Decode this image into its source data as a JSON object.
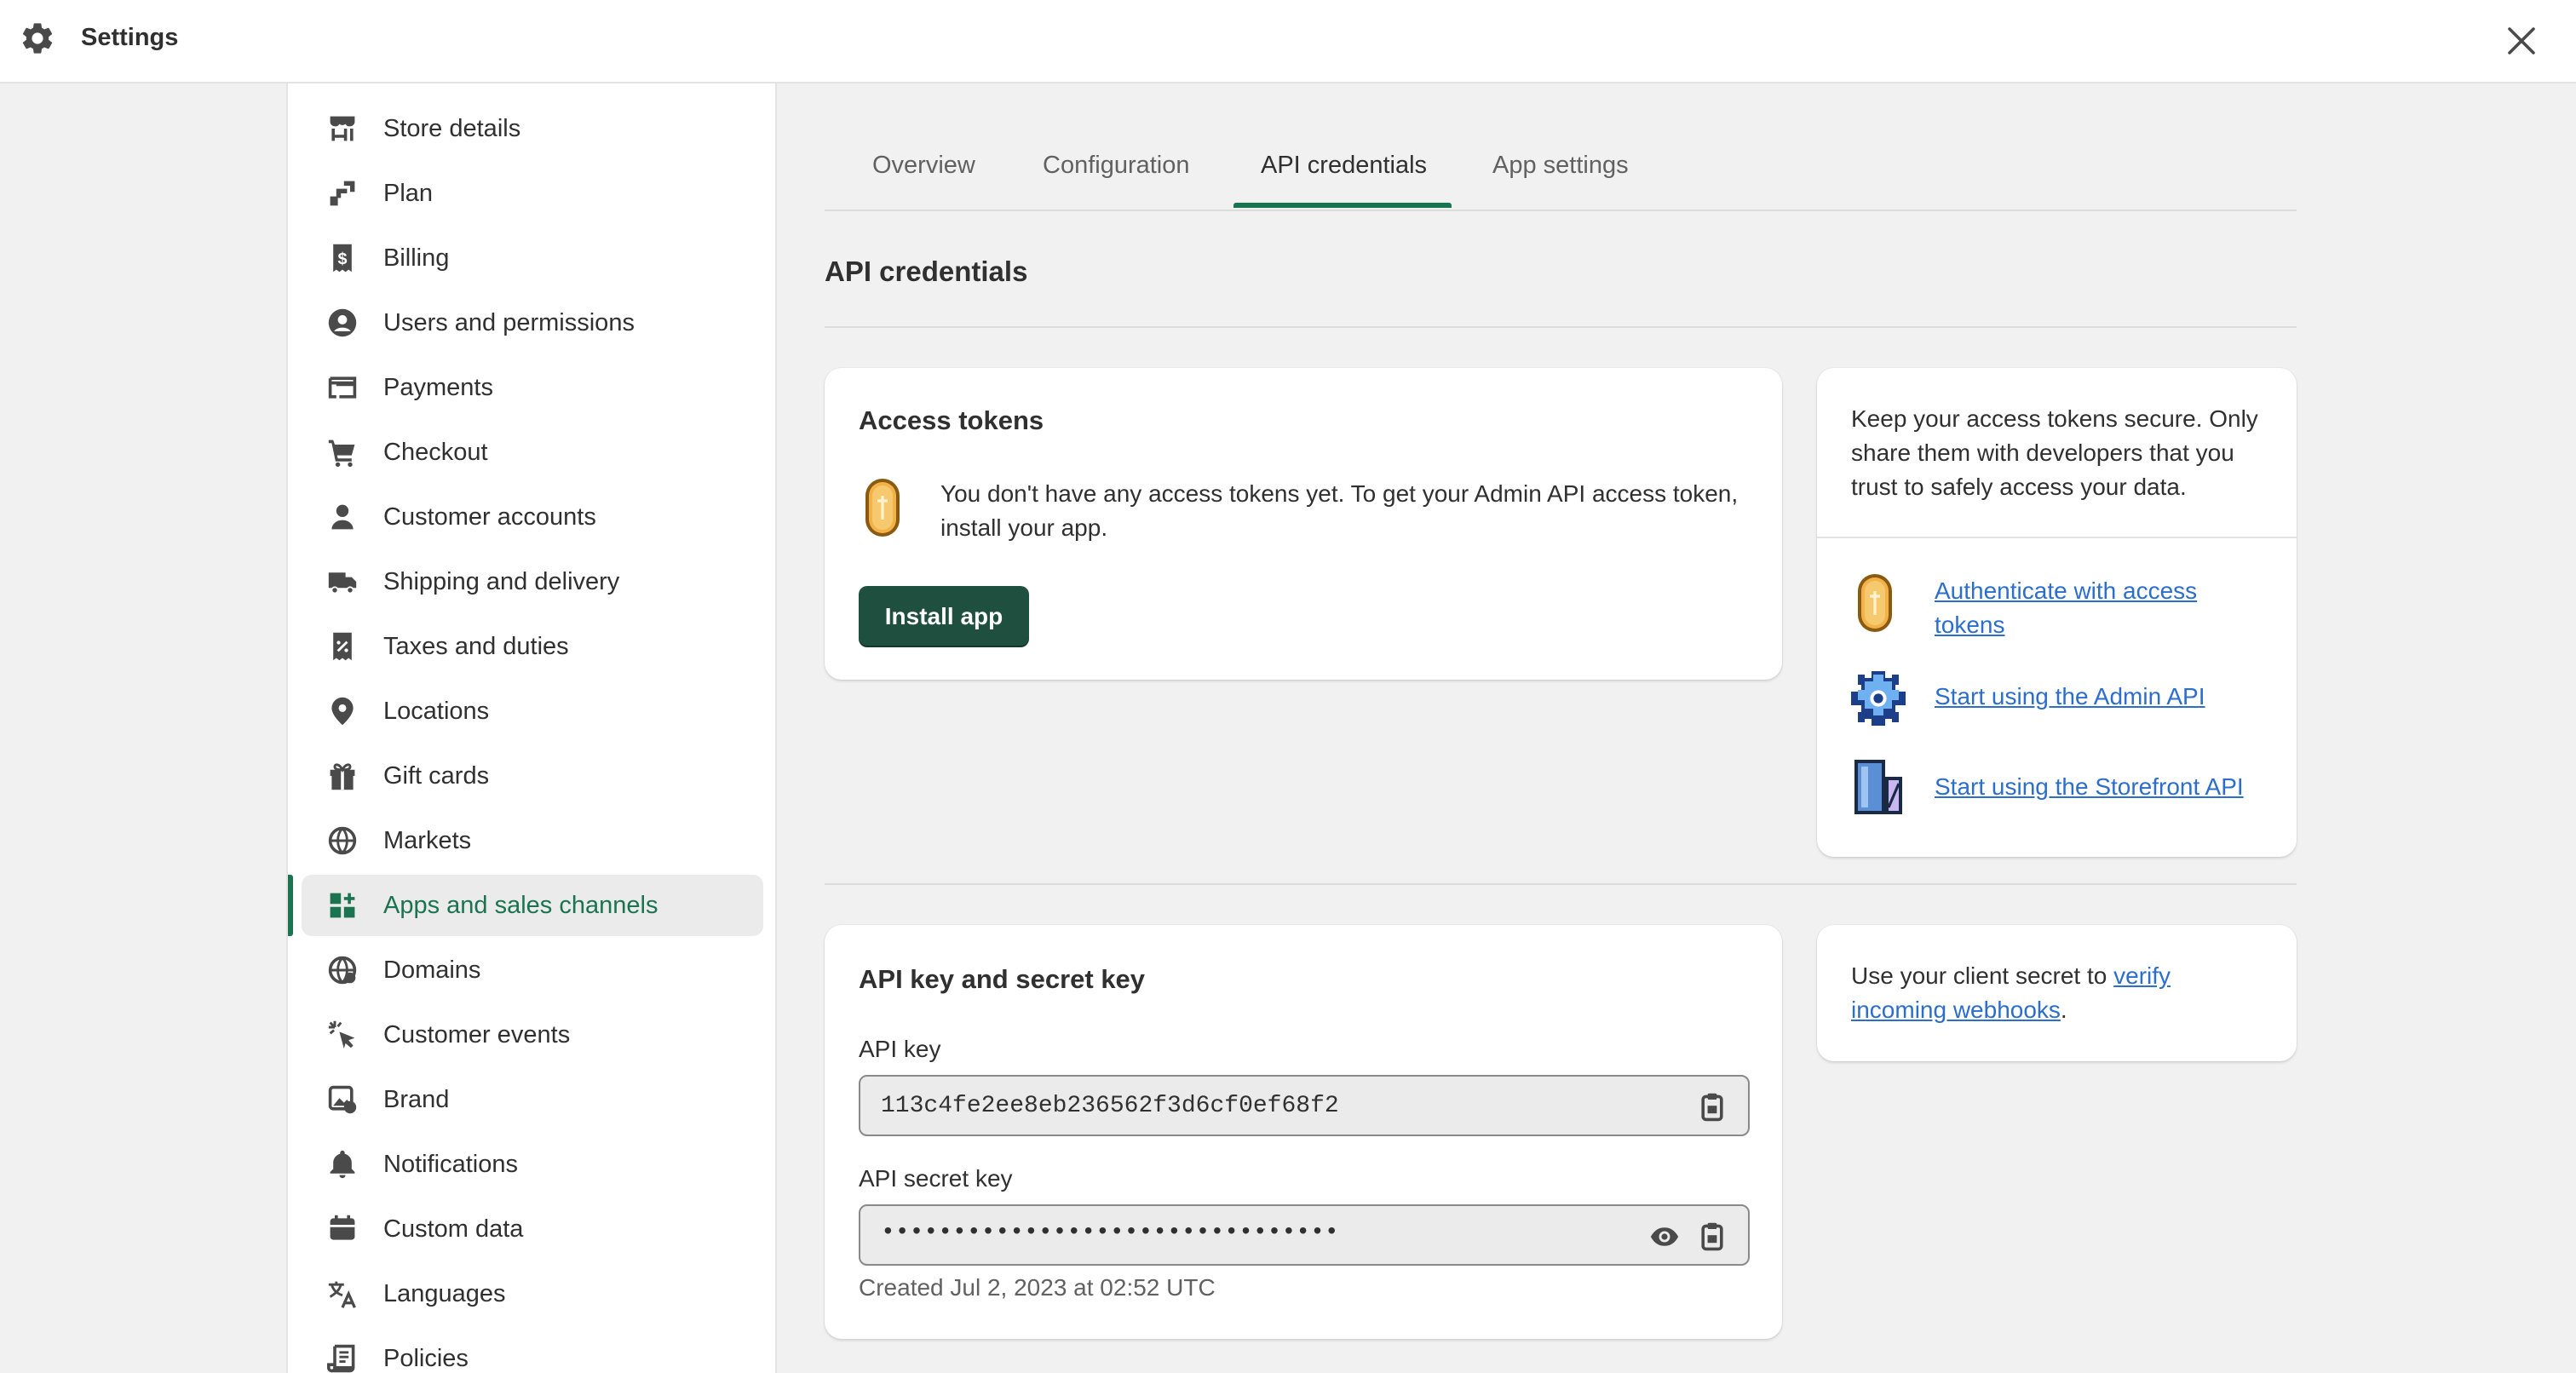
{
  "window": {
    "title": "Settings"
  },
  "sidebar": {
    "items": [
      {
        "label": "Store details"
      },
      {
        "label": "Plan"
      },
      {
        "label": "Billing"
      },
      {
        "label": "Users and permissions"
      },
      {
        "label": "Payments"
      },
      {
        "label": "Checkout"
      },
      {
        "label": "Customer accounts"
      },
      {
        "label": "Shipping and delivery"
      },
      {
        "label": "Taxes and duties"
      },
      {
        "label": "Locations"
      },
      {
        "label": "Gift cards"
      },
      {
        "label": "Markets"
      },
      {
        "label": "Apps and sales channels",
        "active": true
      },
      {
        "label": "Domains"
      },
      {
        "label": "Customer events"
      },
      {
        "label": "Brand"
      },
      {
        "label": "Notifications"
      },
      {
        "label": "Custom data"
      },
      {
        "label": "Languages"
      },
      {
        "label": "Policies"
      }
    ]
  },
  "tabs": [
    {
      "label": "Overview"
    },
    {
      "label": "Configuration"
    },
    {
      "label": "API credentials",
      "active": true
    },
    {
      "label": "App settings"
    }
  ],
  "main": {
    "section_title": "API credentials",
    "access_tokens": {
      "title": "Access tokens",
      "message": "You don't have any access tokens yet. To get your Admin API access token, install your app.",
      "install_label": "Install app"
    },
    "tips": {
      "text": "Keep your access tokens secure. Only share them with developers that you trust to safely access your data.",
      "links": [
        {
          "label": "Authenticate with access tokens",
          "icon": "coin-icon"
        },
        {
          "label": "Start using the Admin API",
          "icon": "gear-pixel-icon"
        },
        {
          "label": "Start using the Storefront API",
          "icon": "storefront-pixel-icon"
        }
      ]
    },
    "keys": {
      "title": "API key and secret key",
      "api_key_label": "API key",
      "api_key_value": "113c4fe2ee8eb236562f3d6cf0ef68f2",
      "secret_label": "API secret key",
      "secret_value": "••••••••••••••••••••••••••••••••",
      "created": "Created Jul 2, 2023 at 02:52 UTC"
    },
    "webhook_note": {
      "prefix": "Use your client secret to ",
      "link": "verify incoming webhooks",
      "suffix": "."
    }
  },
  "colors": {
    "accent": "#1a7450",
    "primary_button": "#1f4f3f",
    "link": "#2c6ecb"
  }
}
